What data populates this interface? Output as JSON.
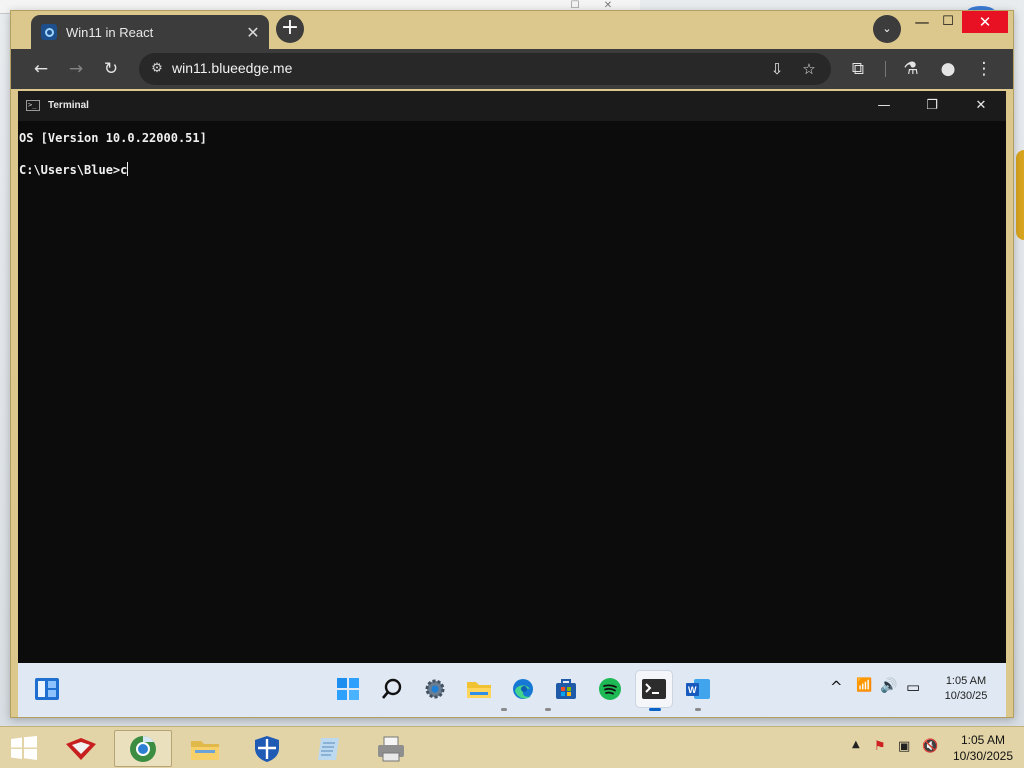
{
  "browser": {
    "tab_title": "Win11 in React",
    "tab_close": "✕",
    "new_tab": "+",
    "tab_search": "⌄",
    "window_controls": {
      "minimize": "—",
      "maximize": "☐",
      "close": "✕"
    },
    "nav": {
      "back": "←",
      "forward": "→",
      "reload": "↻"
    },
    "url": "win11.blueedge.me",
    "site_info": "⚙",
    "toolbar_icons": {
      "install": "⇩",
      "bookmark": "☆",
      "extensions": "⧉",
      "labs": "⚗",
      "profile": "●",
      "menu": "⋮"
    }
  },
  "terminal": {
    "title": "Terminal",
    "icon": ">_",
    "controls": {
      "minimize": "—",
      "restore": "❐",
      "close": "✕"
    },
    "lines": [
      "OS [Version 10.0.22000.51]",
      "C:\\Users\\Blue>c"
    ]
  },
  "win11_taskbar": {
    "apps": [
      "start-icon",
      "search-icon",
      "settings-icon",
      "file-explorer-icon",
      "edge-icon",
      "store-icon",
      "spotify-icon",
      "terminal-icon",
      "word-icon"
    ],
    "tray": {
      "chevron": "^",
      "wifi": "📶",
      "volume": "🔊",
      "battery": "▭"
    },
    "time": "1:05 AM",
    "date": "10/30/25"
  },
  "host_taskbar": {
    "apps": [
      "start-icon",
      "red-app-icon",
      "chrome-icon",
      "folder-icon",
      "shield-icon",
      "notepad-icon",
      "printer-icon"
    ],
    "tray": {
      "chevron": "▲",
      "network": "⚑",
      "monitor": "▣",
      "volume": "🔇"
    },
    "time": "1:05 AM",
    "date": "10/30/2025"
  }
}
